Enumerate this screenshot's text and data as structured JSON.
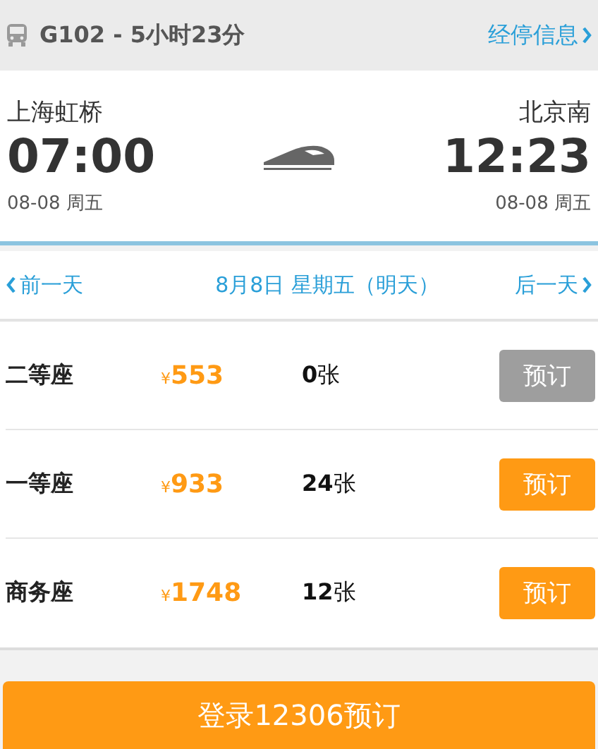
{
  "header": {
    "title": "G102 - 5小时23分",
    "link": "经停信息"
  },
  "journey": {
    "from": {
      "station": "上海虹桥",
      "time": "07:00",
      "date": "08-08 周五"
    },
    "to": {
      "station": "北京南",
      "time": "12:23",
      "date": "08-08 周五"
    }
  },
  "date_nav": {
    "prev": "前一天",
    "current": "8月8日 星期五（明天）",
    "next": "后一天"
  },
  "seats": [
    {
      "name": "二等座",
      "currency": "¥",
      "price": "553",
      "count": "**0**张",
      "button": "预订",
      "disabled": true
    },
    {
      "name": "一等座",
      "currency": "¥",
      "price": "933",
      "count": "**24**张",
      "button": "预订",
      "disabled": false
    },
    {
      "name": "商务座",
      "currency": "¥",
      "price": "1748",
      "count": "**12**张",
      "button": "预订",
      "disabled": false
    }
  ],
  "login_button": "登录12306预订"
}
